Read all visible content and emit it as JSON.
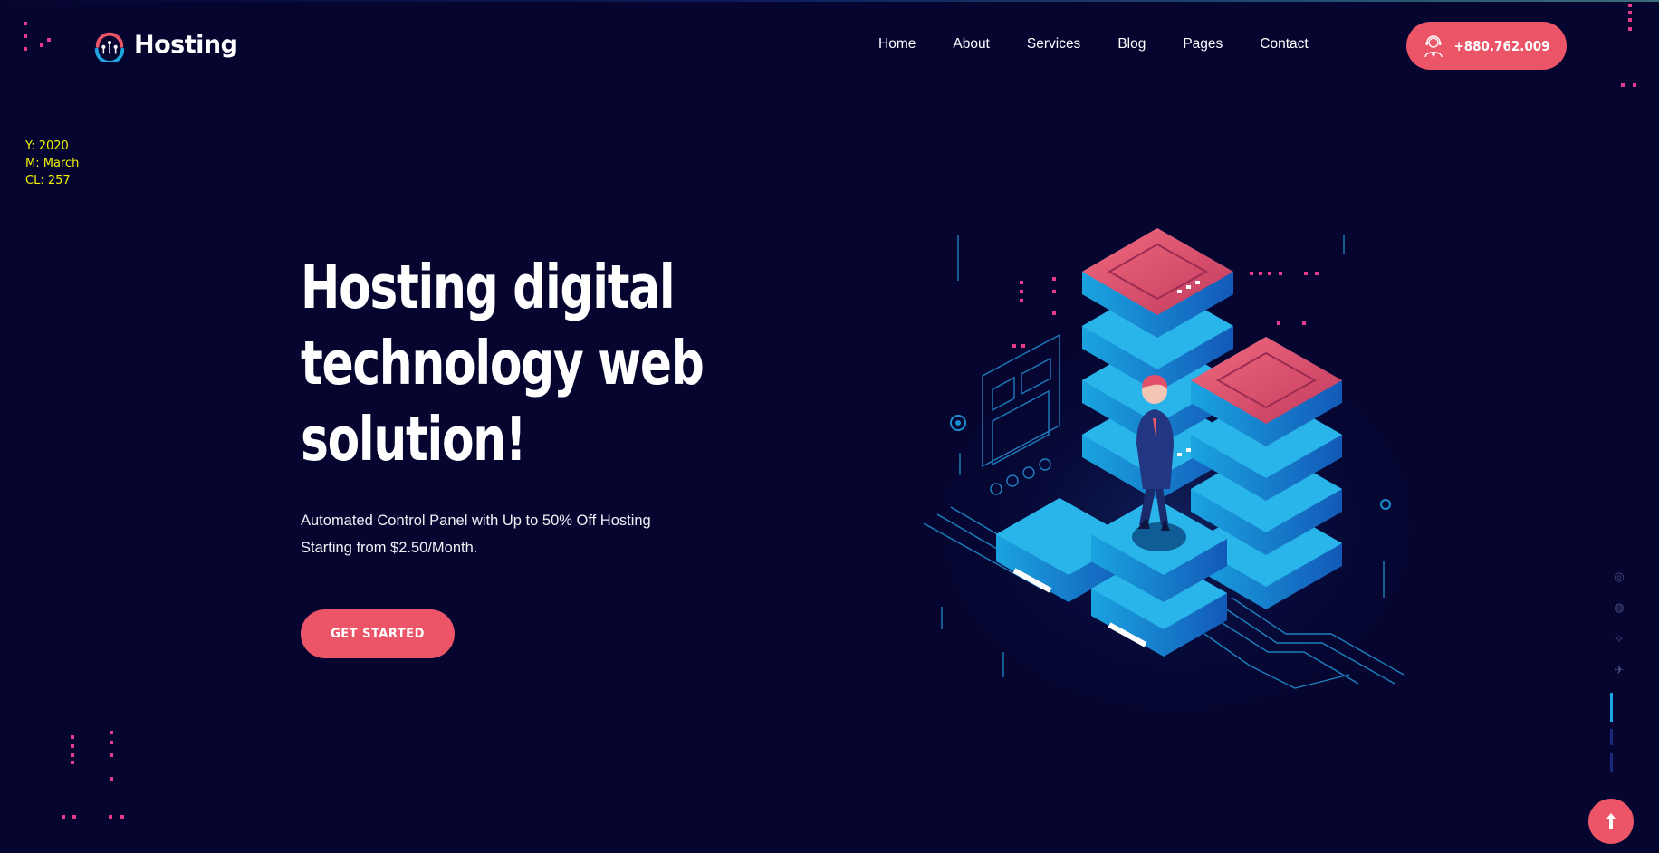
{
  "brand": {
    "name": "Hosting",
    "accent": "#ec5568",
    "background": "#050530"
  },
  "nav": {
    "items": [
      {
        "label": "Home"
      },
      {
        "label": "About"
      },
      {
        "label": "Services"
      },
      {
        "label": "Blog"
      },
      {
        "label": "Pages"
      },
      {
        "label": "Contact"
      }
    ]
  },
  "header": {
    "phone": "+880.762.009",
    "phone_icon": "support-agent-icon"
  },
  "debug": {
    "year": "Y: 2020",
    "month": "M: March",
    "cl": "CL: 257"
  },
  "hero": {
    "title": "Hosting digital technology web solution!",
    "subtitle": "Automated Control Panel with Up to 50% Off Hosting Starting from $2.50/Month.",
    "cta_label": "GET STARTED"
  },
  "side_rail": {
    "icons": [
      "instagram-icon",
      "globe-icon",
      "dribbble-icon",
      "plane-icon"
    ]
  },
  "scroll_top": {
    "icon": "arrow-up-icon"
  }
}
